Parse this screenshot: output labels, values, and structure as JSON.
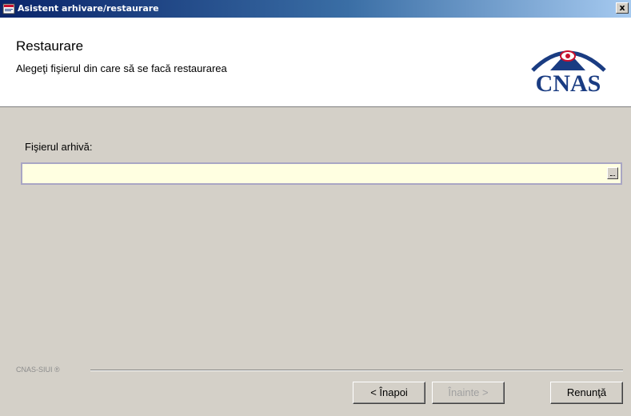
{
  "window": {
    "title": "Asistent arhivare/restaurare",
    "close_label": "x"
  },
  "header": {
    "title": "Restaurare",
    "subtitle": "Alegeţi fişierul din care să se facă restaurarea",
    "logo_text": "CNAS",
    "logo_color": "#1a3c82",
    "logo_accent_color": "#c8102e"
  },
  "content": {
    "field_label": "Fişierul arhivă:",
    "field_value": "",
    "field_background": "#ffffe1",
    "browse_icon": "ellipsis-icon"
  },
  "footer": {
    "brand_label": "CNAS-SIUI ®",
    "back_label": "< Înapoi",
    "next_label": "Înainte >",
    "cancel_label": "Renunţă",
    "next_enabled": false
  }
}
